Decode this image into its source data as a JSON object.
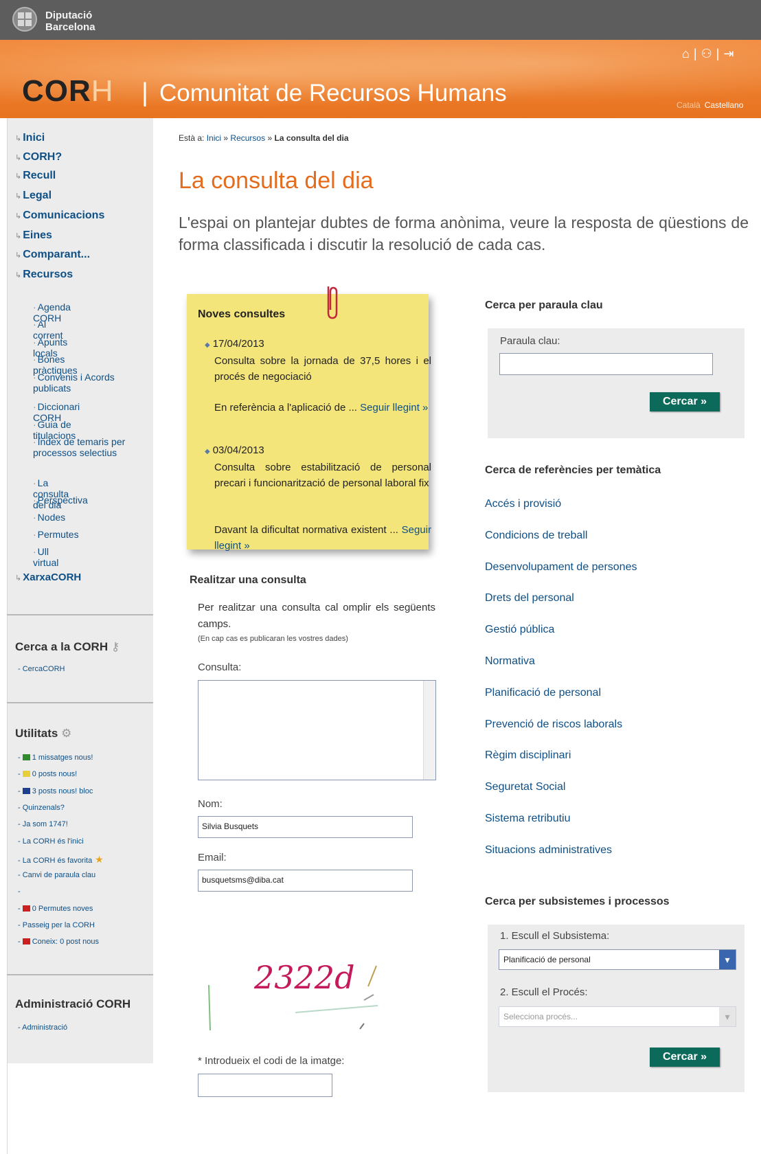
{
  "header": {
    "org_line1": "Diputació",
    "org_line2": "Barcelona",
    "brand_cor": "COR",
    "brand_h": "H",
    "brand_sep": "|",
    "title": "Comunitat de Recursos Humans",
    "lang_ca": "Català",
    "lang_es": "Castellano",
    "icons": [
      "home-icon",
      "sitemap-icon",
      "logout-icon"
    ],
    "icon_sep": "|"
  },
  "sidebar": {
    "nav": [
      {
        "label": "Inici"
      },
      {
        "label": "CORH?"
      },
      {
        "label": "Recull"
      },
      {
        "label": "Legal"
      },
      {
        "label": "Comunicacions"
      },
      {
        "label": "Eines"
      },
      {
        "label": "Comparant..."
      },
      {
        "label": "Recursos"
      }
    ],
    "sub": [
      {
        "label": "Agenda CORH"
      },
      {
        "label": "Al corrent"
      },
      {
        "label": "Apunts locals"
      },
      {
        "label": "Bones pràctiques"
      },
      {
        "label": "Convenis i Acords publicats"
      },
      {
        "label": "Diccionari CORH"
      },
      {
        "label": "Guia de titulacions"
      },
      {
        "label": "Índex de temaris per processos selectius"
      },
      {
        "label": "La consulta del dia"
      },
      {
        "label": "Perspectiva"
      },
      {
        "label": "Nodes"
      },
      {
        "label": "Permutes"
      },
      {
        "label": "Ull virtual"
      }
    ],
    "xarxa": "XarxaCORH",
    "search_title": "Cerca a la CORH",
    "search_link": "CercaCORH",
    "utils_title": "Utilitats",
    "utils": [
      {
        "text": "1 missatges nous!",
        "flag": "#2e8b2e"
      },
      {
        "text": "0 posts nous!",
        "flag": "#e6cf3a"
      },
      {
        "text": "3 posts nous! bloc",
        "flag": "#1d3f8f"
      },
      {
        "text": "Quinzenals?",
        "flag": ""
      },
      {
        "text": "Ja som 1747!",
        "flag": ""
      },
      {
        "text": "La CORH és l'inici",
        "flag": ""
      },
      {
        "text": "La CORH és favorita",
        "flag": ""
      },
      {
        "text": "Canvi de paraula clau",
        "flag": ""
      },
      {
        "text": "",
        "flag": ""
      },
      {
        "text": "0 Permutes noves",
        "flag": "#cc1f1f"
      },
      {
        "text": "Passeig per la CORH",
        "flag": ""
      },
      {
        "text": "Coneix: 0 post nous",
        "flag": "#cc1f1f"
      }
    ],
    "admin_title": "Administració CORH",
    "admin_link": "Administració"
  },
  "breadcrumb": {
    "prefix": "Està a:",
    "items": [
      "Inici",
      "Recursos",
      "La consulta del dia"
    ],
    "sep": "»"
  },
  "main": {
    "title": "La consulta del dia",
    "intro": "L'espai on plantejar dubtes de forma anònima, veure la resposta de qüestions de forma classificada i discutir la resolució de cada cas."
  },
  "note": {
    "title": "Noves consultes",
    "entries": [
      {
        "date": "17/04/2013",
        "title": "Consulta sobre la jornada de 37,5 hores i el procés de negociació",
        "excerpt": "En referència a l'aplicació de ...",
        "link": "Seguir llegint »"
      },
      {
        "date": "03/04/2013",
        "title": "Consulta sobre estabilització de personal precari i funcionarització de personal laboral fix",
        "excerpt": "Davant la dificultat normativa existent ...",
        "link": "Seguir llegint »"
      }
    ]
  },
  "form": {
    "title": "Realitzar una consulta",
    "desc": "Per realitzar una consulta cal omplir els següents camps.",
    "privacy": "(En cap cas es publicaran les vostres dades)",
    "consulta_label": "Consulta:",
    "nom_label": "Nom:",
    "nom_value": "Silvia Busquets",
    "email_label": "Email:",
    "email_value": "busquetsms@diba.cat",
    "captcha_code": "2322d",
    "captcha_label": "* Introdueix el codi de la imatge:"
  },
  "keyword": {
    "title": "Cerca per paraula clau",
    "label": "Paraula clau:",
    "button": "Cercar »"
  },
  "themes": {
    "title": "Cerca de referències per temàtica",
    "items": [
      "Accés i provisió",
      "Condicions de treball",
      "Desenvolupament de persones",
      "Drets del personal",
      "Gestió pública",
      "Normativa",
      "Planificació de personal",
      "Prevenció de riscos laborals",
      "Règim disciplinari",
      "Seguretat Social",
      "Sistema retributiu",
      "Situacions administratives"
    ]
  },
  "subsystems": {
    "title": "Cerca per subsistemes i processos",
    "step1": "1. Escull el Subsistema:",
    "step1_value": "Planificació de personal",
    "step2": "2. Escull el Procés:",
    "step2_placeholder": "Selecciona procés...",
    "button": "Cercar »"
  },
  "colors": {
    "accent": "#e56c1c",
    "link": "#0e4f86",
    "button": "#0b6a5a",
    "note": "#f4e57a"
  }
}
